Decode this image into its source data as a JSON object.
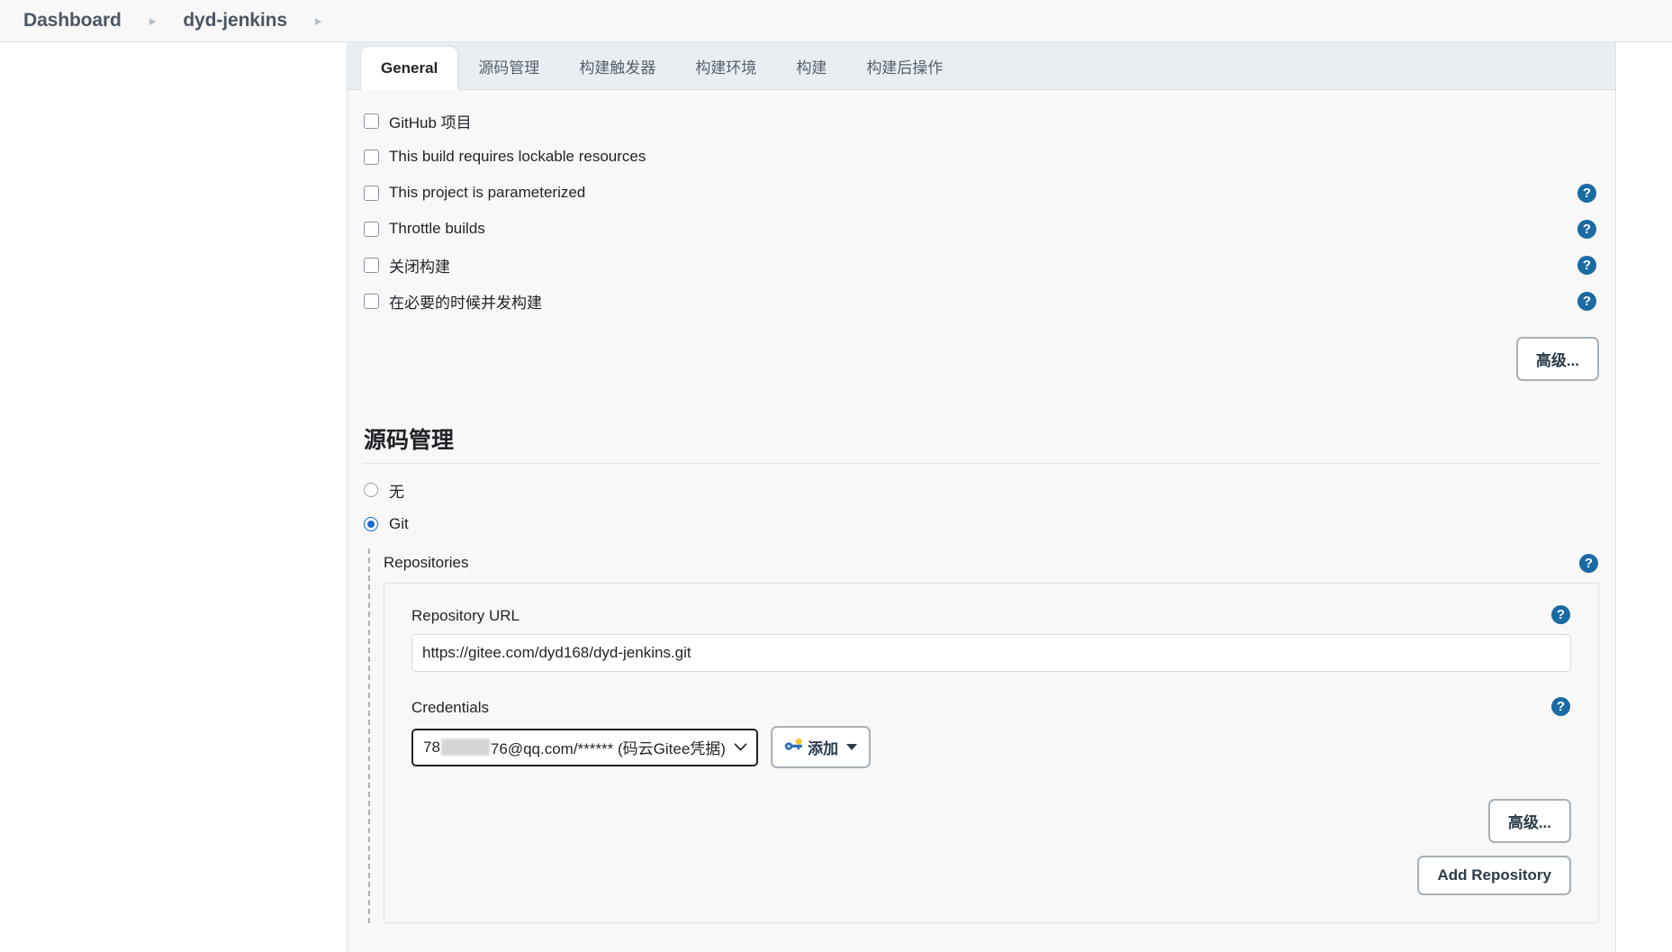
{
  "breadcrumb": {
    "items": [
      {
        "label": "Dashboard"
      },
      {
        "label": "dyd-jenkins"
      }
    ],
    "separator": "▸"
  },
  "tabs": [
    {
      "label": "General",
      "active": true
    },
    {
      "label": "源码管理",
      "active": false
    },
    {
      "label": "构建触发器",
      "active": false
    },
    {
      "label": "构建环境",
      "active": false
    },
    {
      "label": "构建",
      "active": false
    },
    {
      "label": "构建后操作",
      "active": false
    }
  ],
  "general": {
    "checkboxes": [
      {
        "label": "GitHub 项目",
        "checked": false,
        "help": false
      },
      {
        "label": "This build requires lockable resources",
        "checked": false,
        "help": false
      },
      {
        "label": "This project is parameterized",
        "checked": false,
        "help": true
      },
      {
        "label": "Throttle builds",
        "checked": false,
        "help": true
      },
      {
        "label": "关闭构建",
        "checked": false,
        "help": true
      },
      {
        "label": "在必要的时候并发构建",
        "checked": false,
        "help": true
      }
    ],
    "advanced_button": "高级..."
  },
  "scm": {
    "title": "源码管理",
    "options": [
      {
        "label": "无",
        "selected": false
      },
      {
        "label": "Git",
        "selected": true
      }
    ],
    "repositories_label": "Repositories",
    "repository_url": {
      "label": "Repository URL",
      "value": "https://gitee.com/dyd168/dyd-jenkins.git",
      "placeholder": ""
    },
    "credentials": {
      "label": "Credentials",
      "value_prefix": "78",
      "value_suffix": "76@qq.com/****** (码云Gitee凭据)",
      "redacted": true,
      "add_button": "添加",
      "add_icon": "key-icon"
    },
    "advanced_button": "高级...",
    "add_repository_button": "Add Repository"
  },
  "icons": {
    "help": "?",
    "chevron_down": "⌄"
  },
  "colors": {
    "accent": "#1b6ac9",
    "help_blue": "#1a6aa3",
    "tabbar_bg": "#e9eef2",
    "panel_bg": "#f8f8f8",
    "text": "#1f2328"
  }
}
